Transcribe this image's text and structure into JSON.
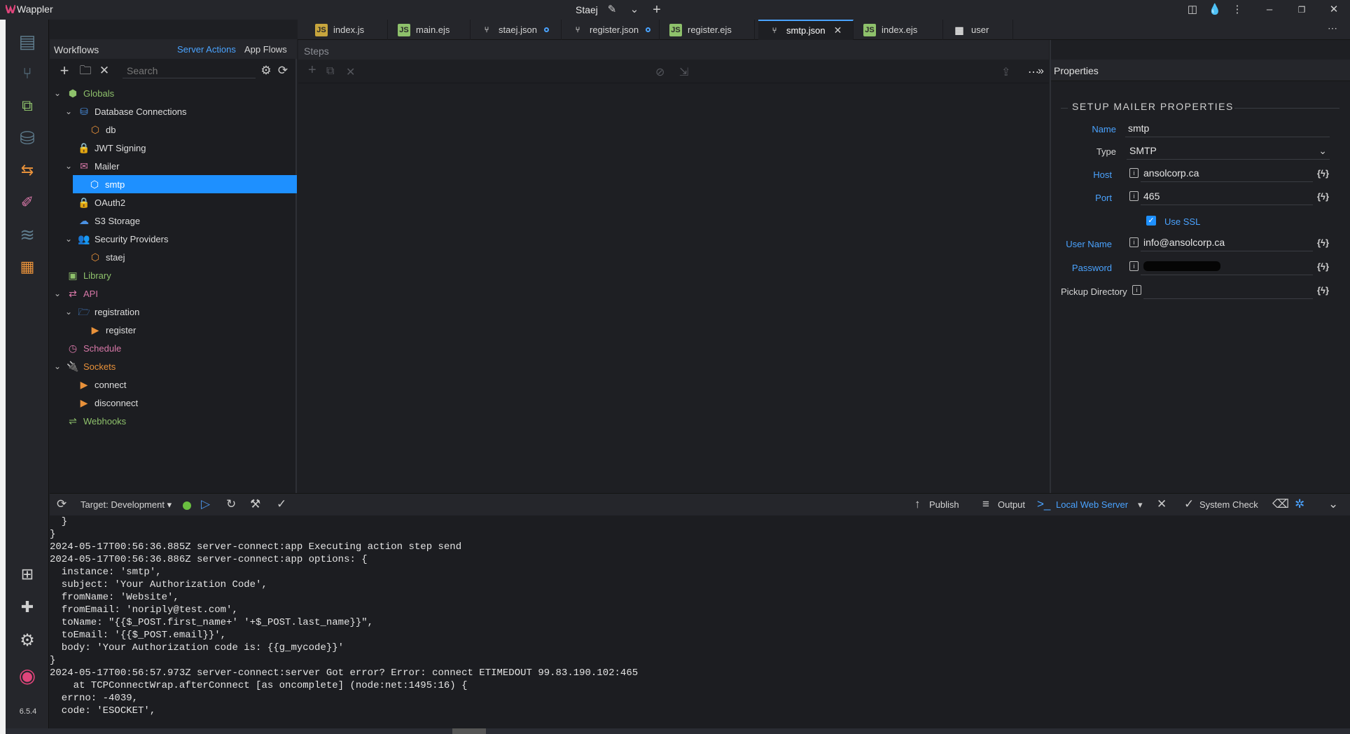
{
  "app": {
    "name": "Wappler",
    "project": "Staej",
    "version": "6.5.4"
  },
  "activity_icons": [
    "pages-icon",
    "git-icon",
    "workflows-icon",
    "database-icon",
    "routing-icon",
    "design-icon",
    "layers-icon",
    "tasks-icon",
    "extensions-icon",
    "puzzle-icon",
    "settings-icon",
    "account-icon"
  ],
  "workflows": {
    "title": "Workflows",
    "tab_server_actions": "Server Actions",
    "tab_app_flows": "App Flows",
    "search_placeholder": "Search",
    "tree": [
      {
        "label": "Globals",
        "level": 0,
        "expanded": true,
        "color": "#8ec16b"
      },
      {
        "label": "Database Connections",
        "level": 1,
        "expanded": true
      },
      {
        "label": "db",
        "level": 2
      },
      {
        "label": "JWT Signing",
        "level": 1
      },
      {
        "label": "Mailer",
        "level": 1,
        "expanded": true
      },
      {
        "label": "smtp",
        "level": 2,
        "selected": true
      },
      {
        "label": "OAuth2",
        "level": 1
      },
      {
        "label": "S3 Storage",
        "level": 1
      },
      {
        "label": "Security Providers",
        "level": 1,
        "expanded": true
      },
      {
        "label": "staej",
        "level": 2
      },
      {
        "label": "Library",
        "level": 0,
        "color": "#8ec16b"
      },
      {
        "label": "API",
        "level": 0,
        "expanded": true,
        "color": "#d878a8"
      },
      {
        "label": "registration",
        "level": 1,
        "expanded": true
      },
      {
        "label": "register",
        "level": 2
      },
      {
        "label": "Schedule",
        "level": 0,
        "color": "#d878a8"
      },
      {
        "label": "Sockets",
        "level": 0,
        "expanded": true,
        "color": "#e8913a"
      },
      {
        "label": "connect",
        "level": 1
      },
      {
        "label": "disconnect",
        "level": 1
      },
      {
        "label": "Webhooks",
        "level": 0,
        "color": "#8ec16b"
      }
    ]
  },
  "tabs": [
    {
      "label": "index.js",
      "type": "js"
    },
    {
      "label": "main.ejs",
      "type": "ejs"
    },
    {
      "label": "staej.json",
      "type": "flow",
      "modified": true
    },
    {
      "label": "register.json",
      "type": "flow",
      "modified": true
    },
    {
      "label": "register.ejs",
      "type": "ejs"
    },
    {
      "label": "smtp.json",
      "type": "flow",
      "active": true
    },
    {
      "label": "index.ejs",
      "type": "ejs"
    },
    {
      "label": "user",
      "type": "table"
    }
  ],
  "steps": {
    "title": "Steps"
  },
  "properties": {
    "title": "Properties",
    "section": "SETUP MAILER PROPERTIES",
    "name_label": "Name",
    "name_value": "smtp",
    "type_label": "Type",
    "type_value": "SMTP",
    "host_label": "Host",
    "host_value": "ansolcorp.ca",
    "port_label": "Port",
    "port_value": "465",
    "ssl_label": "Use SSL",
    "ssl_checked": true,
    "user_label": "User Name",
    "user_value": "info@ansolcorp.ca",
    "password_label": "Password",
    "pickup_label": "Pickup Directory",
    "pickup_value": "",
    "fx_label": "{ϟ}"
  },
  "bottombar": {
    "target_label": "Target: Development",
    "publish": "Publish",
    "output": "Output",
    "server": "Local Web Server",
    "system_check": "System Check"
  },
  "console": [
    "  }",
    "}",
    "2024-05-17T00:56:36.885Z server-connect:app Executing action step send",
    "2024-05-17T00:56:36.886Z server-connect:app options: {",
    "  instance: 'smtp',",
    "  subject: 'Your Authorization Code',",
    "  fromName: 'Website',",
    "  fromEmail: 'noriply@test.com',",
    "  toName: \"{{$_POST.first_name+' '+$_POST.last_name}}\",",
    "  toEmail: '{{$_POST.email}}',",
    "  body: 'Your Authorization code is: {{g_mycode}}'",
    "}",
    "2024-05-17T00:56:57.973Z server-connect:server Got error? Error: connect ETIMEDOUT 99.83.190.102:465",
    "    at TCPConnectWrap.afterConnect [as oncomplete] (node:net:1495:16) {",
    "  errno: -4039,",
    "  code: 'ESOCKET',"
  ],
  "colors": {
    "accent": "#1e90ff",
    "link": "#4aa3ff",
    "status_ok": "#6abf40"
  }
}
